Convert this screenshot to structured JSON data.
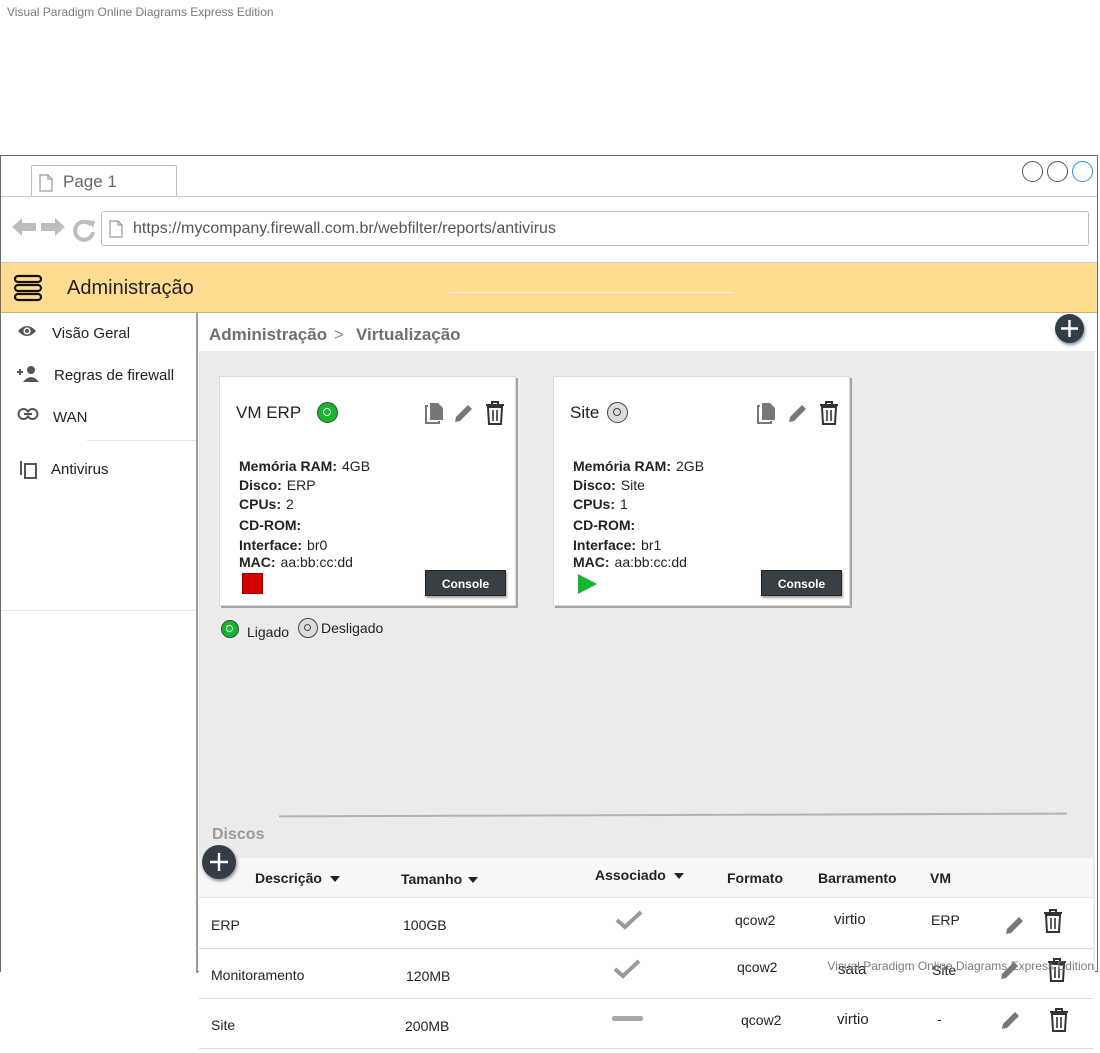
{
  "watermark": "Visual Paradigm Online Diagrams Express Edition",
  "browser": {
    "tab_label": "Page 1",
    "url": "https://mycompany.firewall.com.br/webfilter/reports/antivirus"
  },
  "header": {
    "title": "Administração"
  },
  "sidebar": {
    "items": [
      {
        "label": "Visão Geral",
        "icon": "eye-icon"
      },
      {
        "label": "Regras de firewall",
        "icon": "add-user-icon"
      },
      {
        "label": "WAN",
        "icon": "link-icon"
      },
      {
        "label": "Antivirus",
        "icon": "copy-icon"
      }
    ]
  },
  "breadcrumb": {
    "root": "Administração",
    "separator": ">",
    "current": "Virtualização"
  },
  "vms": [
    {
      "name": "VM ERP",
      "status": "on",
      "props": [
        {
          "label": "Memória RAM:",
          "value": "4GB"
        },
        {
          "label": "Disco:",
          "value": "ERP"
        },
        {
          "label": "CPUs:",
          "value": "2"
        },
        {
          "label": "CD-ROM:",
          "value": ""
        },
        {
          "label": "Interface:",
          "value": "br0"
        },
        {
          "label": "MAC:",
          "value": "aa:bb:cc:dd"
        }
      ],
      "action": "stop",
      "console_label": "Console"
    },
    {
      "name": "Site",
      "status": "off",
      "props": [
        {
          "label": "Memória RAM:",
          "value": "2GB"
        },
        {
          "label": "Disco:",
          "value": "Site"
        },
        {
          "label": "CPUs:",
          "value": "1"
        },
        {
          "label": "CD-ROM:",
          "value": ""
        },
        {
          "label": "Interface:",
          "value": "br1"
        },
        {
          "label": "MAC:",
          "value": "aa:bb:cc:dd"
        }
      ],
      "action": "play",
      "console_label": "Console"
    }
  ],
  "legend": {
    "on_label": "Ligado",
    "off_label": "Desligado"
  },
  "disks": {
    "title": "Discos",
    "columns": [
      "Descrição",
      "Tamanho",
      "Associado",
      "Formato",
      "Barramento",
      "VM"
    ],
    "rows": [
      {
        "descricao": "ERP",
        "tamanho": "100GB",
        "associado": "check",
        "formato": "qcow2",
        "barramento": "virtio",
        "vm": "ERP"
      },
      {
        "descricao": "Monitoramento",
        "tamanho": "120MB",
        "associado": "check",
        "formato": "qcow2",
        "barramento": "sata",
        "vm": "Site"
      },
      {
        "descricao": "Site",
        "tamanho": "200MB",
        "associado": "dash",
        "formato": "qcow2",
        "barramento": "virtio",
        "vm": "-"
      }
    ]
  },
  "colors": {
    "header_bg": "#ffdc8f",
    "status_on": "#12b82c",
    "stop": "#d40000",
    "play": "#12b82c",
    "dark_button": "#3a3f44"
  }
}
